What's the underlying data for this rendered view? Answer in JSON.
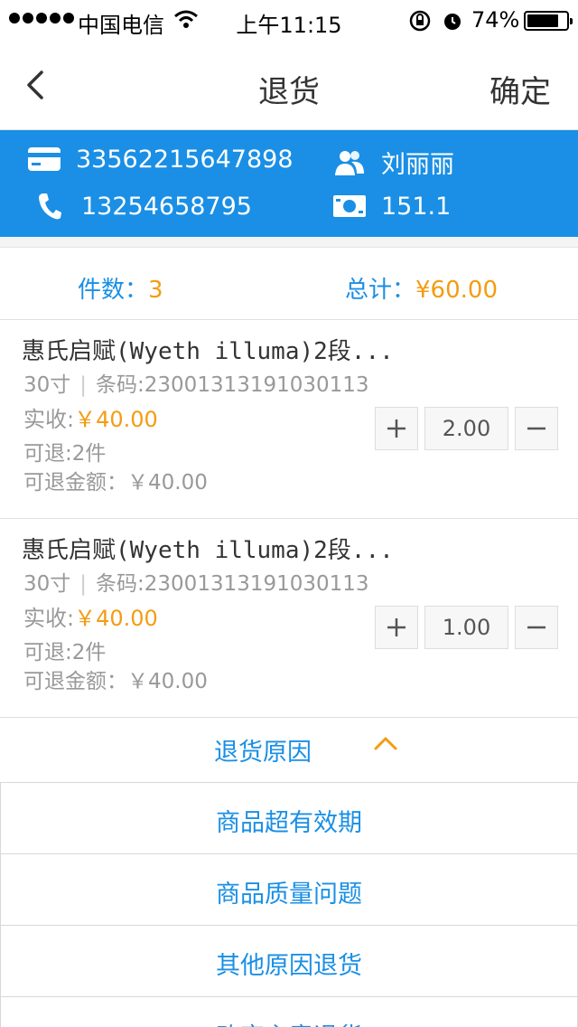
{
  "status_bar": {
    "carrier": "中国电信",
    "time": "上午11:15",
    "battery_pct": "74%",
    "battery_level": 0.74
  },
  "nav": {
    "title": "退货",
    "confirm_label": "确定",
    "back_icon": "chevron-left-icon"
  },
  "customer": {
    "card_number": "33562215647898",
    "name": "刘丽丽",
    "phone": "13254658795",
    "points": "151.1"
  },
  "summary": {
    "qty_label": "件数：",
    "qty_value": "3",
    "total_label": "总计：",
    "total_value": "¥60.00"
  },
  "items": [
    {
      "name": "惠氏启赋(Wyeth illuma)2段...",
      "size": "30寸",
      "barcode": "条码:23001313191030113",
      "paid_label": "实收:",
      "paid_value": "￥40.00",
      "returnable": "可退:2件",
      "return_amount": "可退金额：￥40.00",
      "quantity": "2.00"
    },
    {
      "name": "惠氏启赋(Wyeth illuma)2段...",
      "size": "30寸",
      "barcode": "条码:23001313191030113",
      "paid_label": "实收:",
      "paid_value": "￥40.00",
      "returnable": "可退:2件",
      "return_amount": "可退金额：￥40.00",
      "quantity": "1.00"
    }
  ],
  "reason": {
    "label": "退货原因",
    "options": [
      "商品超有效期",
      "商品质量问题",
      "其他原因退货",
      "改变主意退货"
    ]
  },
  "colors": {
    "accent": "#1a8fe5",
    "price": "#f39c12"
  }
}
